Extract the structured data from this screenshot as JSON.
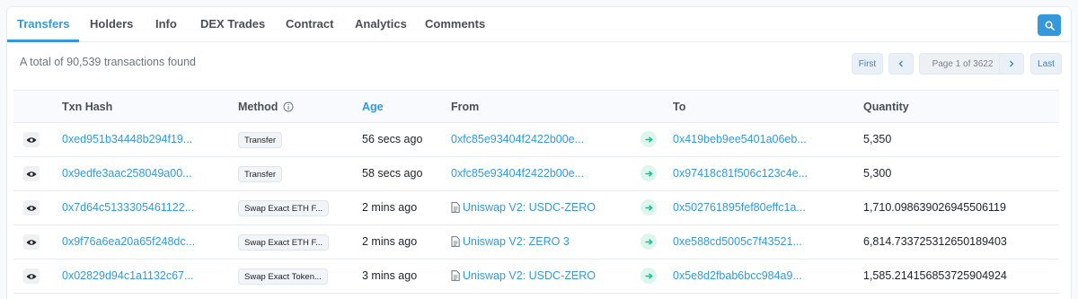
{
  "tabs": [
    "Transfers",
    "Holders",
    "Info",
    "DEX Trades",
    "Contract",
    "Analytics",
    "Comments"
  ],
  "summary": "A total of 90,539 transactions found",
  "pagination": {
    "first": "First",
    "prev": "<",
    "info": "Page 1 of 3622",
    "next": ">",
    "last": "Last"
  },
  "table": {
    "headers": {
      "txn_hash": "Txn Hash",
      "method": "Method",
      "age": "Age",
      "from": "From",
      "to": "To",
      "quantity": "Quantity"
    },
    "rows": [
      {
        "hash": "0xed951b34448b294f19...",
        "method": "Transfer",
        "age": "56 secs ago",
        "from": "0xfc85e93404f2422b00e...",
        "from_is_contract": false,
        "to": "0x419beb9ee5401a06eb...",
        "quantity": "5,350"
      },
      {
        "hash": "0x9edfe3aac258049a00...",
        "method": "Transfer",
        "age": "58 secs ago",
        "from": "0xfc85e93404f2422b00e...",
        "from_is_contract": false,
        "to": "0x97418c81f506c123c4e...",
        "quantity": "5,300"
      },
      {
        "hash": "0x7d64c5133305461122...",
        "method": "Swap Exact ETH F...",
        "age": "2 mins ago",
        "from": "Uniswap V2: USDC-ZERO",
        "from_is_contract": true,
        "to": "0x502761895fef80effc1a...",
        "quantity": "1,710.098639026945506119"
      },
      {
        "hash": "0x9f76a6ea20a65f248dc...",
        "method": "Swap Exact ETH F...",
        "age": "2 mins ago",
        "from": "Uniswap V2: ZERO 3",
        "from_is_contract": true,
        "to": "0xe588cd5005c7f43521...",
        "quantity": "6,814.733725312650189403"
      },
      {
        "hash": "0x02829d94c1a1132c67...",
        "method": "Swap Exact Token...",
        "age": "3 mins ago",
        "from": "Uniswap V2: USDC-ZERO",
        "from_is_contract": true,
        "to": "0x5e8d2fbab6bcc984a9...",
        "quantity": "1,585.214156853725904924"
      }
    ]
  },
  "colors": {
    "accent": "#3498db",
    "arrow_green": "#00c9a7"
  }
}
